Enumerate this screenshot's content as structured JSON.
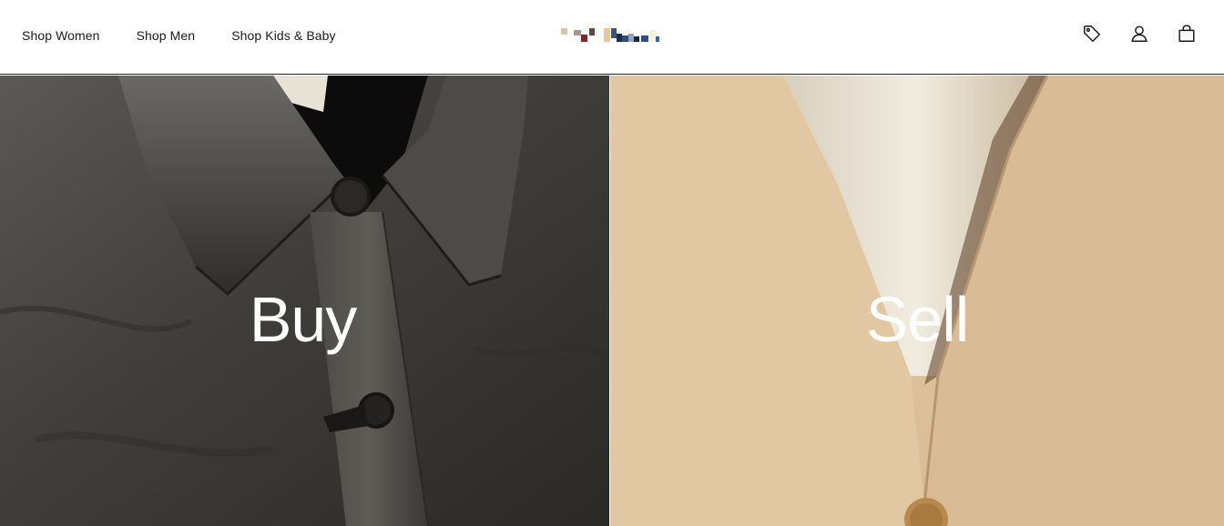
{
  "header": {
    "nav": [
      {
        "label": "Shop Women"
      },
      {
        "label": "Shop Men"
      },
      {
        "label": "Shop Kids & Baby"
      }
    ],
    "icons": [
      "tag-icon",
      "account-icon",
      "bag-icon"
    ]
  },
  "hero": {
    "buy": {
      "title": "Buy"
    },
    "sell": {
      "title": "Sell"
    }
  },
  "colors": {
    "header_bg": "#ffffff",
    "header_border": "#222222",
    "buy_panel": "#3a3935",
    "sell_panel": "#dcc2a0",
    "title_text": "#ffffff"
  }
}
